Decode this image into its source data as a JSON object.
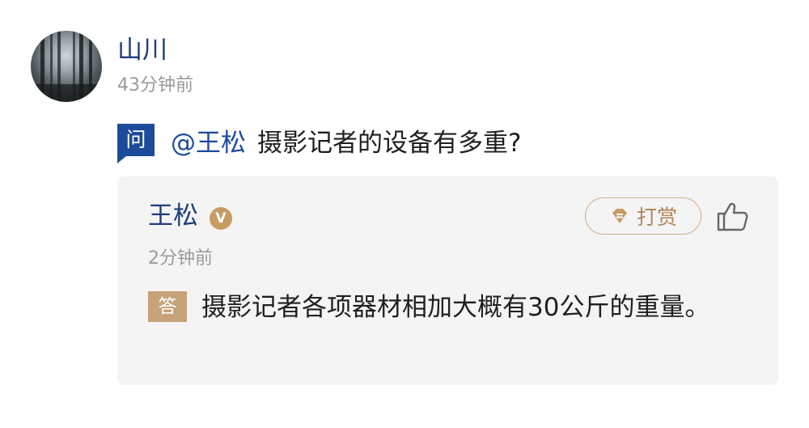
{
  "post": {
    "author": "山川",
    "time": "43分钟前",
    "question_badge": "问",
    "mention": "@王松",
    "question_text": "摄影记者的设备有多重?"
  },
  "answer": {
    "author": "王松",
    "verified_badge": "V",
    "tip_label": "打赏",
    "time": "2分钟前",
    "answer_badge": "答",
    "text": "摄影记者各项器材相加大概有30公斤的重量。"
  },
  "colors": {
    "name_blue": "#1d3f7a",
    "question_badge_blue": "#1d4a9a",
    "answer_badge_tan": "#c8a27a",
    "tip_gold": "#b28556",
    "card_bg": "#f4f4f4",
    "meta_gray": "#9a9a9a"
  },
  "icons": {
    "avatar": "forest-avatar",
    "verified": "verified-v-icon",
    "tip": "diamond-coin-icon",
    "like": "thumbs-up-icon"
  }
}
